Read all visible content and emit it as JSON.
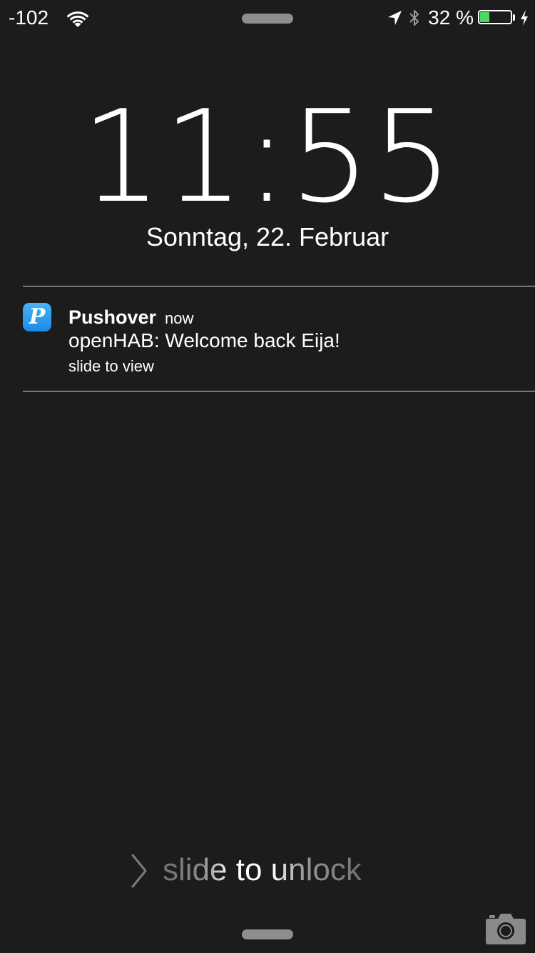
{
  "status_bar": {
    "signal": "-102",
    "wifi_icon": "wifi-icon",
    "location_icon": "location-arrow-icon",
    "bluetooth_icon": "bluetooth-icon",
    "battery_percent": "32 %",
    "battery_level": 0.32,
    "battery_fill_color": "#4cd964",
    "charging_icon": "lightning-bolt-icon"
  },
  "lock_screen": {
    "time": "11:55",
    "date": "Sonntag, 22. Februar"
  },
  "notification": {
    "app_icon": "pushover-p-icon",
    "app_icon_letter": "P",
    "app_name": "Pushover",
    "time": "now",
    "message": "openHAB: Welcome back Eija!",
    "hint": "slide to view",
    "accent_color": "#2196f3"
  },
  "unlock": {
    "chevron_icon": "chevron-right-icon",
    "label": "slide to unlock"
  },
  "bottom": {
    "camera_icon": "camera-icon"
  }
}
